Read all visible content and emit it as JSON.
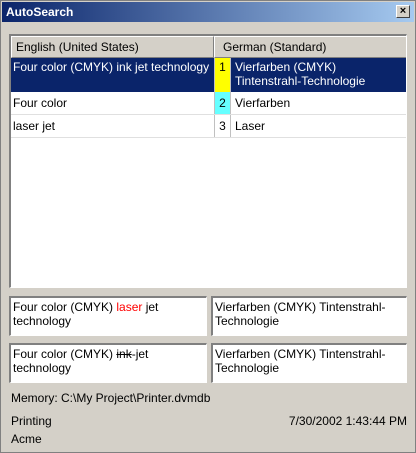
{
  "window": {
    "title": "AutoSearch",
    "close_glyph": "×"
  },
  "columns": {
    "source": "English (United States)",
    "target": "German (Standard)"
  },
  "rows": [
    {
      "source": "Four color (CMYK) ink jet technology",
      "num": "1",
      "num_color": "#ffff00",
      "target": "Vierfarben (CMYK) Tintenstrahl-Technologie",
      "selected": true
    },
    {
      "source": "Four color",
      "num": "2",
      "num_color": "#66ffff",
      "target": "Vierfarben",
      "selected": false
    },
    {
      "source": "laser jet",
      "num": "3",
      "num_color": "#ffffff",
      "target": "Laser",
      "selected": false
    }
  ],
  "compare1": {
    "source_pre": "Four color (CMYK) ",
    "source_changed": "laser",
    "source_post": " jet technology",
    "target": "Vierfarben (CMYK) Tintenstrahl-Technologie"
  },
  "compare2": {
    "source_pre": "Four color (CMYK) ",
    "source_removed": "ink",
    "source_post": "-jet technology",
    "target": "Vierfarben (CMYK) Tintenstrahl-Technologie"
  },
  "status": {
    "memory": "Memory: C:\\My Project\\Printer.dvmdb",
    "subject": "Printing",
    "timestamp": "7/30/2002 1:43:44 PM",
    "client": "Acme"
  },
  "colors": {
    "title_start": "#0a246a",
    "selection": "#0a246a",
    "highlight": "#ff0000"
  }
}
